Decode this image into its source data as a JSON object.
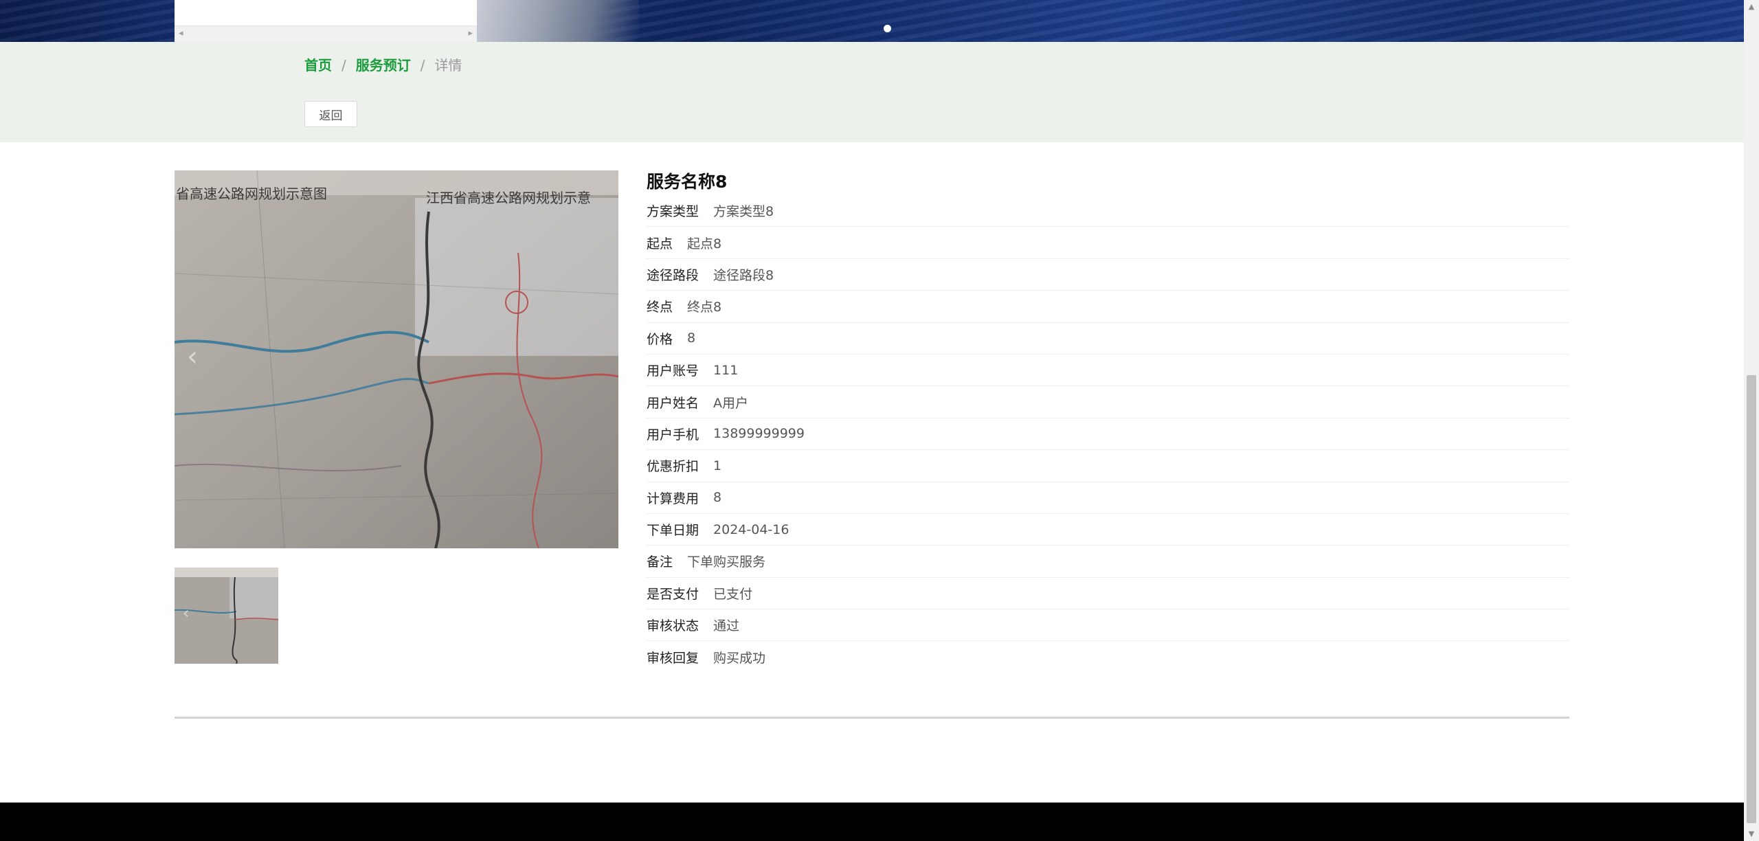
{
  "breadcrumb": {
    "home": "首页",
    "section": "服务预订",
    "current": "详情",
    "separator": "/"
  },
  "back_button": "返回",
  "detail": {
    "title": "服务名称8",
    "fields": [
      {
        "label": "方案类型",
        "value": "方案类型8"
      },
      {
        "label": "起点",
        "value": "起点8"
      },
      {
        "label": "途径路段",
        "value": "途径路段8"
      },
      {
        "label": "终点",
        "value": "终点8"
      },
      {
        "label": "价格",
        "value": "8"
      },
      {
        "label": "用户账号",
        "value": "111"
      },
      {
        "label": "用户姓名",
        "value": "A用户"
      },
      {
        "label": "用户手机",
        "value": "13899999999"
      },
      {
        "label": "优惠折扣",
        "value": "1"
      },
      {
        "label": "计算费用",
        "value": "8"
      },
      {
        "label": "下单日期",
        "value": "2024-04-16"
      },
      {
        "label": "备注",
        "value": "下单购买服务"
      },
      {
        "label": "是否支付",
        "value": "已支付"
      },
      {
        "label": "审核状态",
        "value": "通过"
      },
      {
        "label": "审核回复",
        "value": "购买成功"
      }
    ]
  },
  "image": {
    "caption_left": "省高速公路网规划示意图",
    "caption_right": "江西省高速公路网规划示意",
    "nav_prev_icon": "chevron-left-icon",
    "nav_next_icon": "chevron-right-icon"
  },
  "colors": {
    "accent_green": "#1a9b3c",
    "crumb_bg": "#edf1ec",
    "footer_bg": "#000000"
  }
}
